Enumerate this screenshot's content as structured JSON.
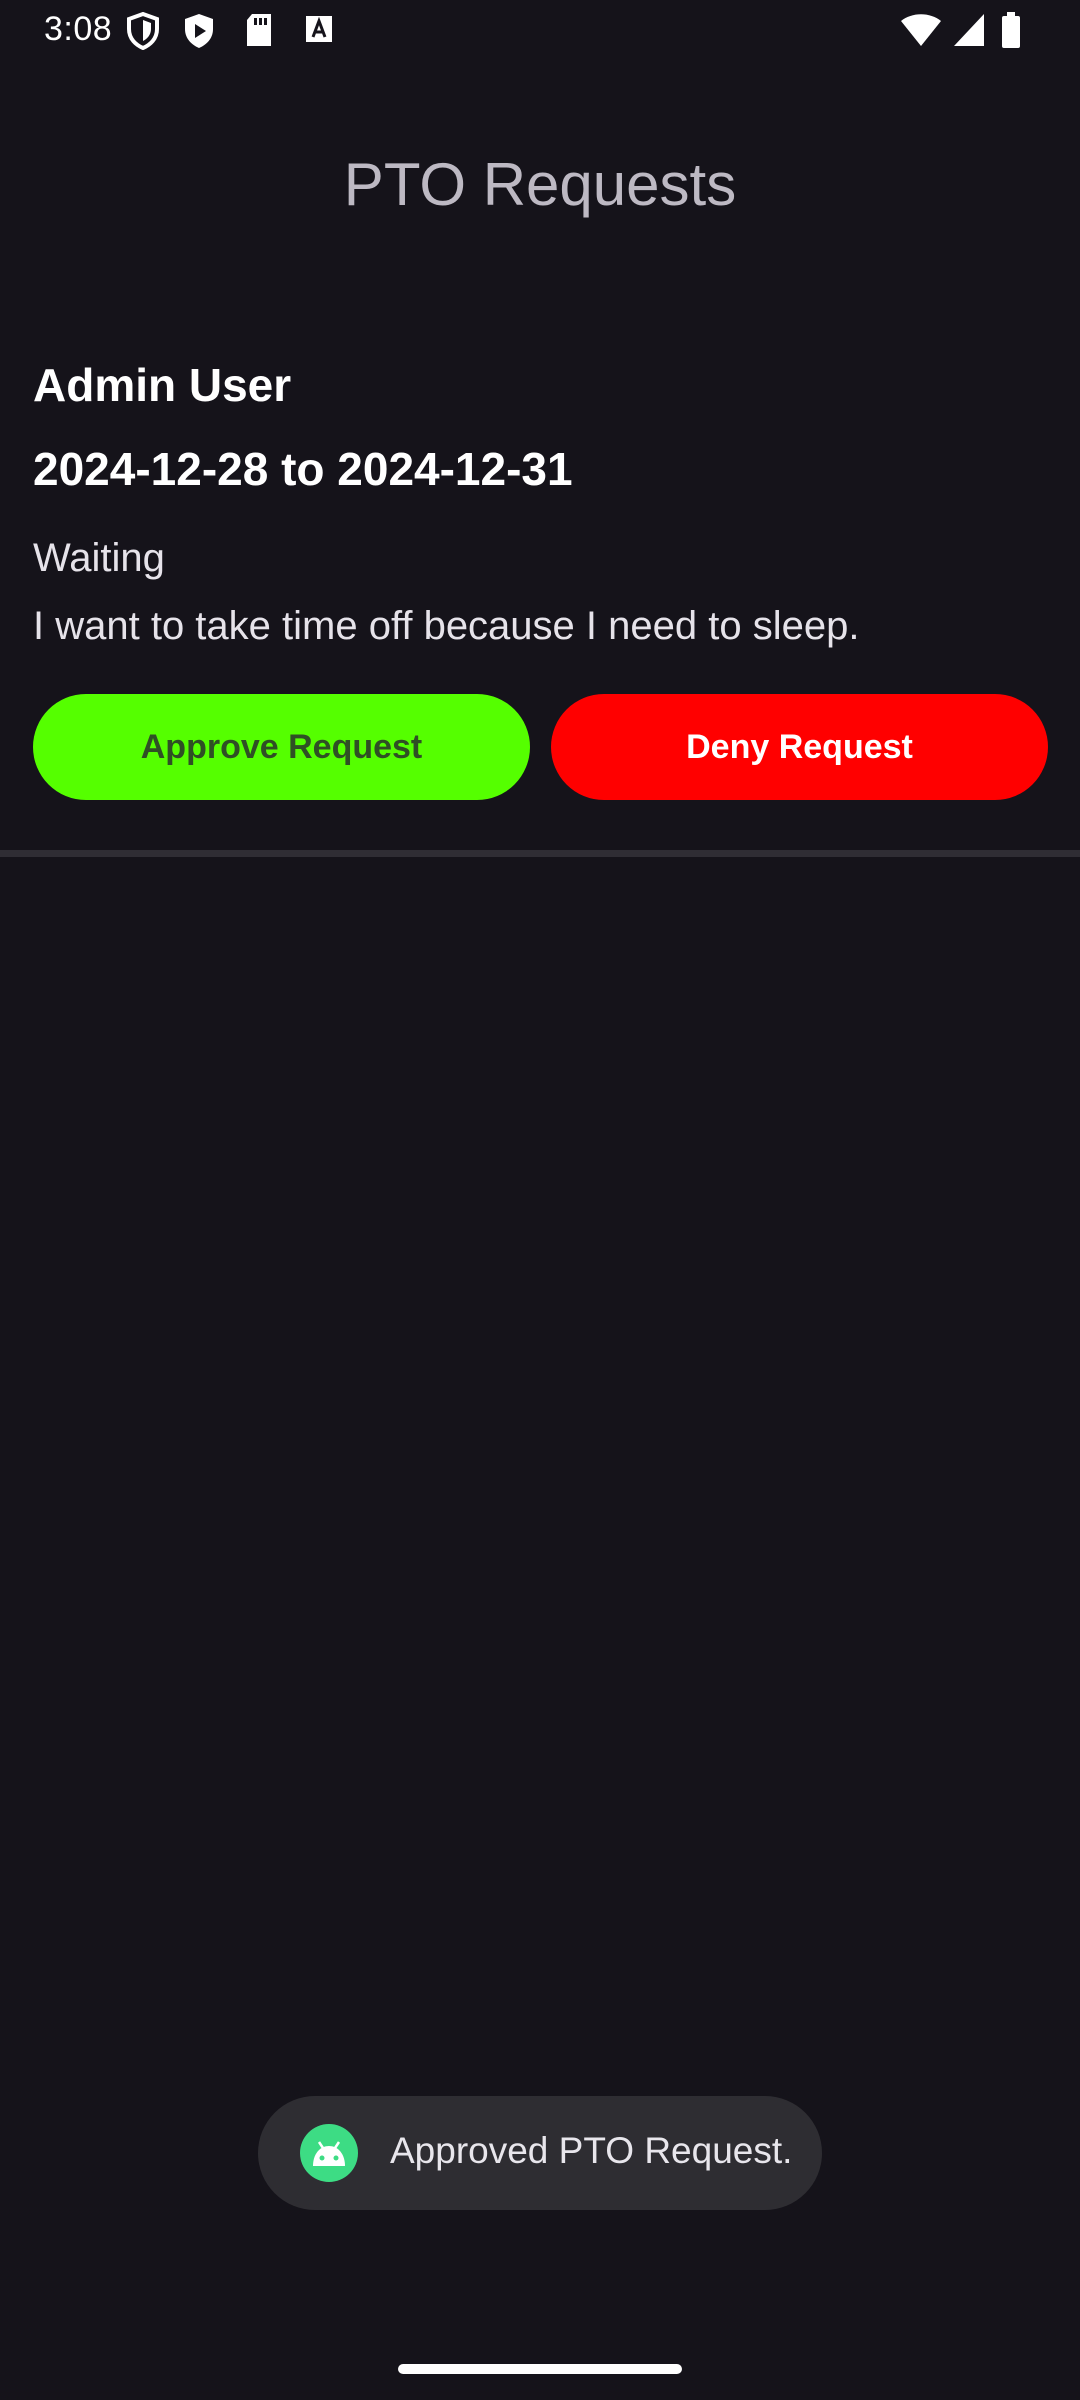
{
  "status_bar": {
    "time": "3:08",
    "left_icons": [
      "shield-icon",
      "play-shield-icon",
      "sd-card-icon",
      "keyboard-a-icon"
    ],
    "right_icons": [
      "wifi-icon",
      "signal-icon",
      "battery-icon"
    ]
  },
  "header": {
    "title": "PTO Requests"
  },
  "request": {
    "name": "Admin User",
    "dates": "2024-12-28 to 2024-12-31",
    "status": "Waiting",
    "reason": "I want to take time off because I need to sleep.",
    "approve_label": "Approve Request",
    "deny_label": "Deny Request",
    "colors": {
      "approve_bg": "#55ff00",
      "approve_text": "#2f4f25",
      "deny_bg": "#ff0000",
      "deny_text": "#ffffff"
    }
  },
  "toast": {
    "icon": "android-icon",
    "message": "Approved PTO Request."
  }
}
